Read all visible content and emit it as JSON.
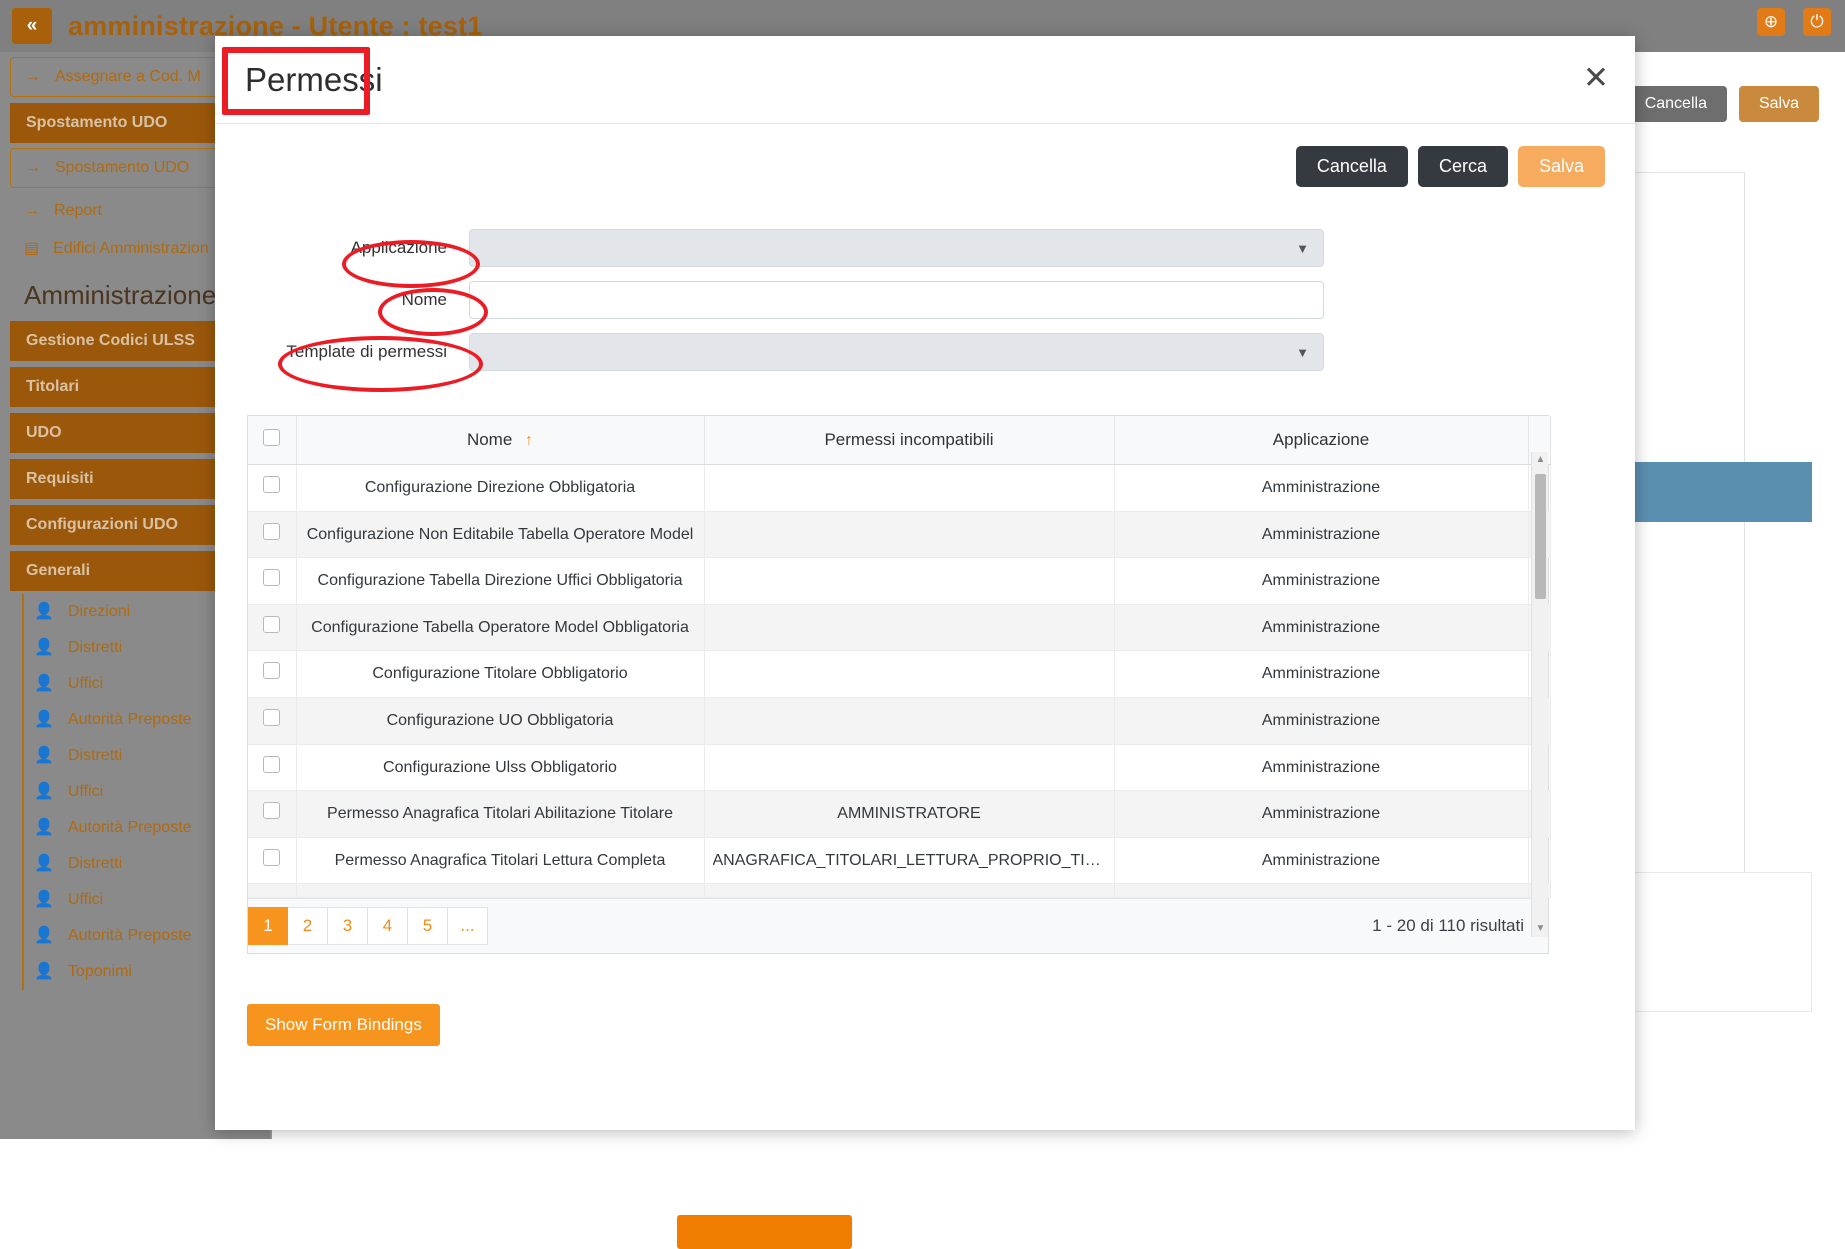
{
  "app": {
    "title": "amministrazione - Utente : test1",
    "collapse_icon": "«",
    "globe_icon": "globe-icon",
    "power_icon": "power-icon",
    "globe_glyph": "⊕",
    "power_glyph": "⏻"
  },
  "sidebar": {
    "items": [
      {
        "type": "link",
        "label": "Assegnare a Cod. M",
        "icon": "arrow-right-icon",
        "glyph": "→"
      },
      {
        "type": "section",
        "label": "Spostamento UDO"
      },
      {
        "type": "link",
        "label": "Spostamento UDO",
        "icon": "arrow-right-icon",
        "glyph": "→"
      },
      {
        "type": "plain",
        "label": "Report",
        "icon": "arrow-right-icon",
        "glyph": "→"
      },
      {
        "type": "plain",
        "label": "Edifici Amministrazion",
        "icon": "building-icon",
        "glyph": "▤"
      },
      {
        "type": "heading",
        "label": "Amministrazione"
      },
      {
        "type": "section",
        "label": "Gestione Codici ULSS"
      },
      {
        "type": "section",
        "label": "Titolari"
      },
      {
        "type": "section",
        "label": "UDO"
      },
      {
        "type": "section",
        "label": "Requisiti"
      },
      {
        "type": "section",
        "label": "Configurazioni UDO"
      },
      {
        "type": "section",
        "label": "Generali"
      },
      {
        "type": "sub",
        "label": "Direzioni",
        "icon": "user-edit-icon",
        "glyph": "👤"
      },
      {
        "type": "sub",
        "label": "Distretti",
        "icon": "user-edit-icon",
        "glyph": "👤"
      },
      {
        "type": "sub",
        "label": "Uffici",
        "icon": "user-edit-icon",
        "glyph": "👤"
      },
      {
        "type": "sub",
        "label": "Autorità Preposte",
        "icon": "user-edit-icon",
        "glyph": "👤"
      },
      {
        "type": "sub",
        "label": "Distretti",
        "icon": "user-edit-icon",
        "glyph": "👤"
      },
      {
        "type": "sub",
        "label": "Uffici",
        "icon": "user-edit-icon",
        "glyph": "👤"
      },
      {
        "type": "sub",
        "label": "Autorità Preposte",
        "icon": "user-edit-icon",
        "glyph": "👤"
      },
      {
        "type": "sub",
        "label": "Distretti",
        "icon": "user-edit-icon",
        "glyph": "👤"
      },
      {
        "type": "sub",
        "label": "Uffici",
        "icon": "user-edit-icon",
        "glyph": "👤"
      },
      {
        "type": "sub",
        "label": "Autorità Preposte",
        "icon": "user-edit-icon",
        "glyph": "👤"
      },
      {
        "type": "sub",
        "label": "Toponimi",
        "icon": "user-edit-icon",
        "glyph": "👤"
      }
    ],
    "scroll_down_glyph": "▼"
  },
  "page": {
    "cancel_label": "Cancella",
    "save_label": "Salva"
  },
  "modal": {
    "title": "Permessi",
    "close_glyph": "✕",
    "actions": {
      "cancel_label": "Cancella",
      "search_label": "Cerca",
      "save_label": "Salva"
    },
    "form": {
      "applicazione": {
        "label": "Applicazione",
        "value": "",
        "caret": "▼"
      },
      "nome": {
        "label": "Nome",
        "value": "",
        "placeholder": ""
      },
      "template": {
        "label": "Template di permessi",
        "value": "",
        "caret": "▼"
      }
    },
    "table": {
      "columns": [
        "",
        "Nome",
        "Permessi incompatibili",
        "Applicazione"
      ],
      "sort_column": "Nome",
      "sort_arrow": "↑",
      "rows": [
        {
          "nome": "Configurazione Direzione Obbligatoria",
          "incompatibili": "",
          "applicazione": "Amministrazione"
        },
        {
          "nome": "Configurazione Non Editabile Tabella Operatore Model",
          "incompatibili": "",
          "applicazione": "Amministrazione"
        },
        {
          "nome": "Configurazione Tabella Direzione Uffici Obbligatoria",
          "incompatibili": "",
          "applicazione": "Amministrazione"
        },
        {
          "nome": "Configurazione Tabella Operatore Model Obbligatoria",
          "incompatibili": "",
          "applicazione": "Amministrazione"
        },
        {
          "nome": "Configurazione Titolare Obbligatorio",
          "incompatibili": "",
          "applicazione": "Amministrazione"
        },
        {
          "nome": "Configurazione UO Obbligatoria",
          "incompatibili": "",
          "applicazione": "Amministrazione"
        },
        {
          "nome": "Configurazione Ulss Obbligatorio",
          "incompatibili": "",
          "applicazione": "Amministrazione"
        },
        {
          "nome": "Permesso Anagrafica Titolari Abilitazione Titolare",
          "incompatibili": "AMMINISTRATORE",
          "applicazione": "Amministrazione"
        },
        {
          "nome": "Permesso Anagrafica Titolari Lettura Completa",
          "incompatibili": "ANAGRAFICA_TITOLARI_LETTURA_PROPRIO_TITOLA...",
          "applicazione": "Amministrazione"
        }
      ],
      "scroll_up_glyph": "▲",
      "scroll_down_glyph": "▼"
    },
    "pagination": {
      "pages": [
        "1",
        "2",
        "3",
        "4",
        "5",
        "..."
      ],
      "active": "1",
      "results_text": "1 - 20 di 110 risultati"
    },
    "show_bindings_label": "Show Form Bindings"
  },
  "annotations": {
    "title_box": "Permessi",
    "ellipse_applicazione": "Applicazione",
    "ellipse_nome": "Nome",
    "ellipse_template": "Template di permessi",
    "color": "#ec1c24"
  }
}
